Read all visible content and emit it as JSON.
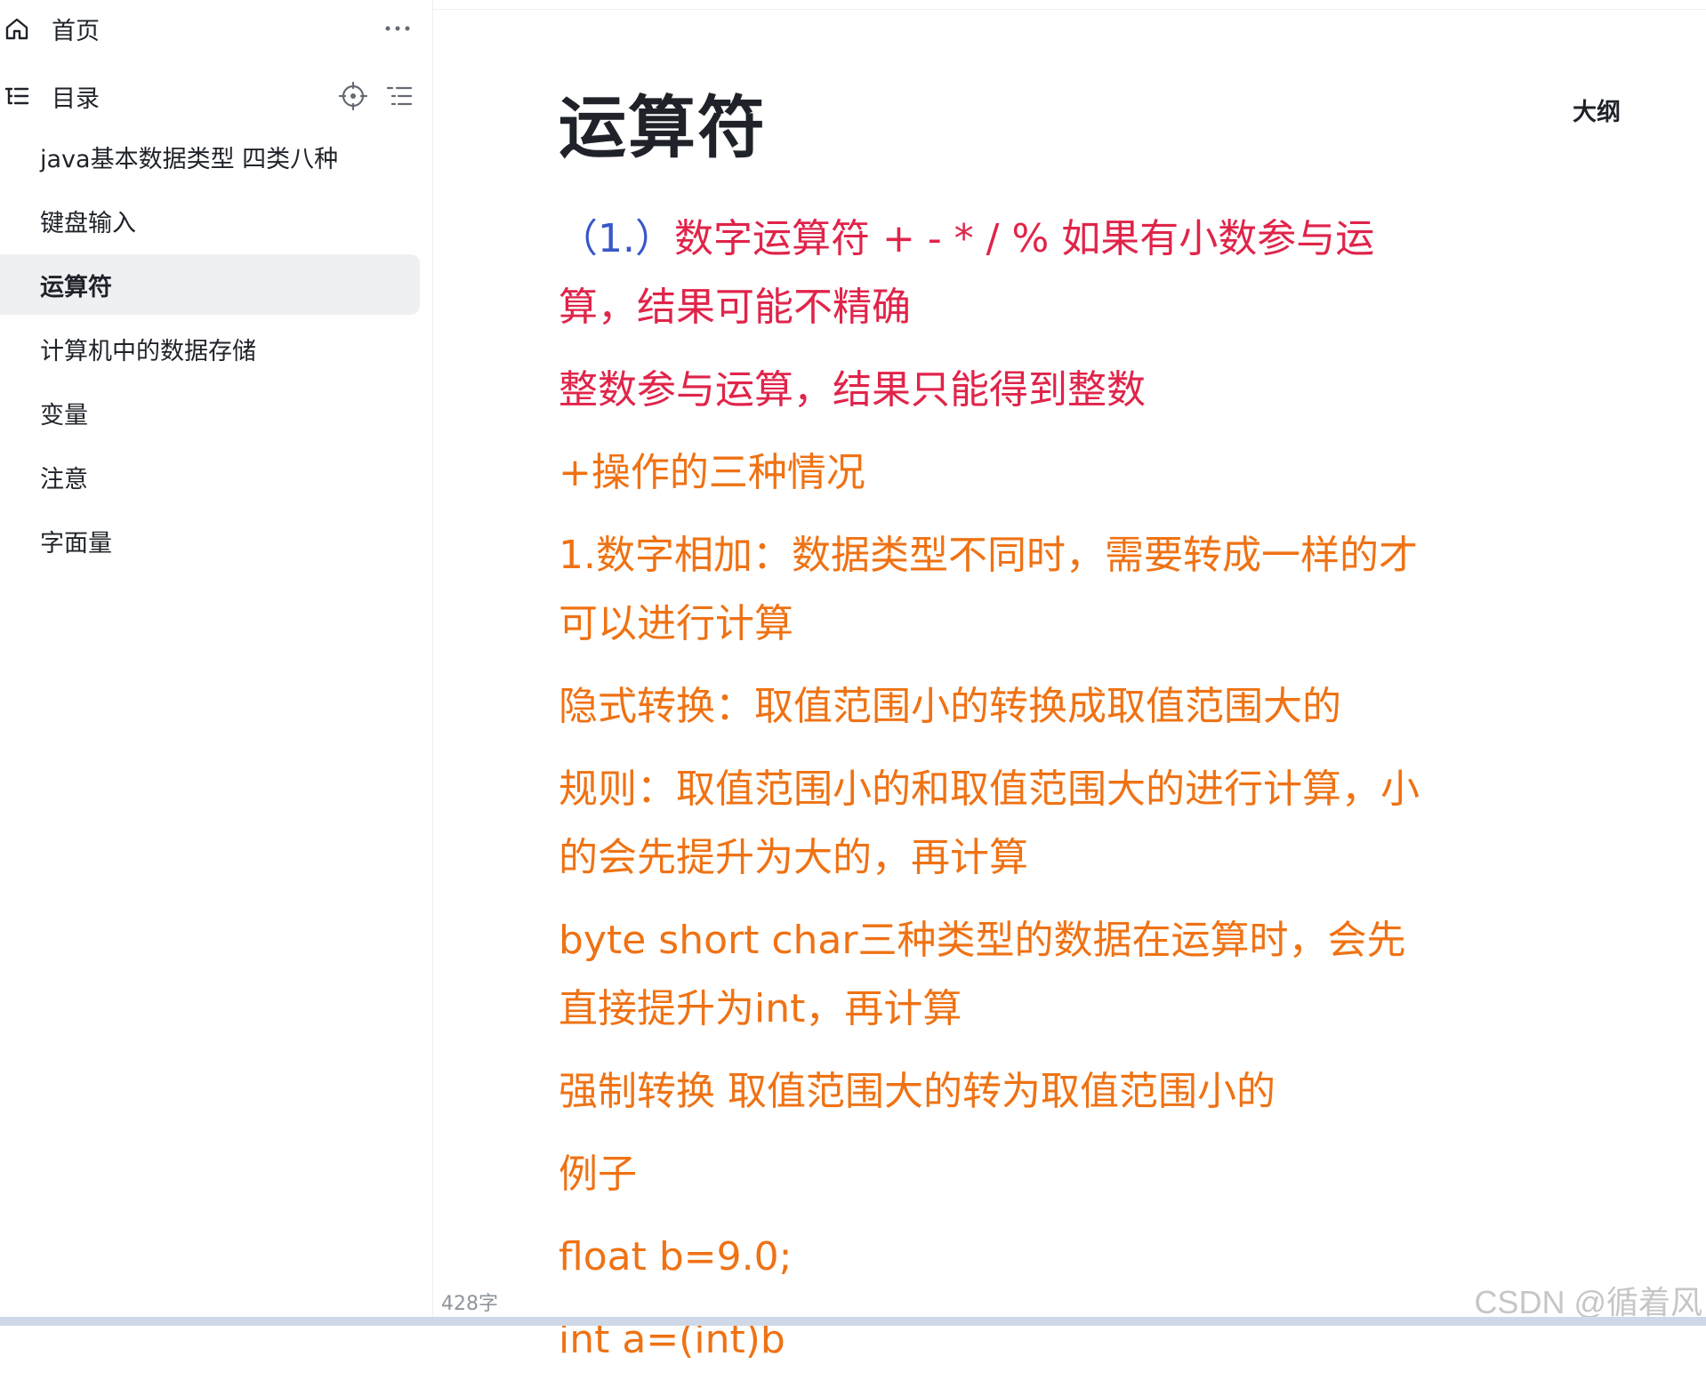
{
  "sidebar": {
    "home_label": "首页",
    "toc_label": "目录",
    "icons": {
      "home": "home-icon",
      "more": "more-dots-icon",
      "toc": "toc-list-icon",
      "locate": "locate-crosshair-icon",
      "collapse": "outline-toggle-icon"
    },
    "items": [
      {
        "label": "java基本数据类型 四类八种",
        "active": false
      },
      {
        "label": "键盘输入",
        "active": false
      },
      {
        "label": "运算符",
        "active": true
      },
      {
        "label": "计算机中的数据存储",
        "active": false
      },
      {
        "label": "变量",
        "active": false
      },
      {
        "label": "注意",
        "active": false
      },
      {
        "label": "字面量",
        "active": false
      }
    ]
  },
  "main": {
    "title": "运算符",
    "outline_label": "大纲",
    "paragraphs": {
      "p1_prefix": "（1.）",
      "p1_rest": "数字运算符  + - * / %  如果有小数参与运算，结果可能不精确",
      "p2": "整数参与运算，结果只能得到整数",
      "p3": "+操作的三种情况",
      "p4": "1.数字相加：数据类型不同时，需要转成一样的才可以进行计算",
      "p5": "隐式转换：取值范围小的转换成取值范围大的",
      "p6": "规则：取值范围小的和取值范围大的进行计算，小的会先提升为大的，再计算",
      "p7": "byte short char三种类型的数据在运算时，会先直接提升为int，再计算",
      "p8": "强制转换 取值范围大的转为取值范围小的",
      "p9": "例子",
      "p10": "float b=9.0;",
      "p11": "int a=(int)b"
    },
    "colors": {
      "blue": "#3857c8",
      "red": "#e0244a",
      "orange": "#ef7214"
    }
  },
  "footer": {
    "word_count": "428字",
    "watermark": "CSDN @循着风"
  }
}
